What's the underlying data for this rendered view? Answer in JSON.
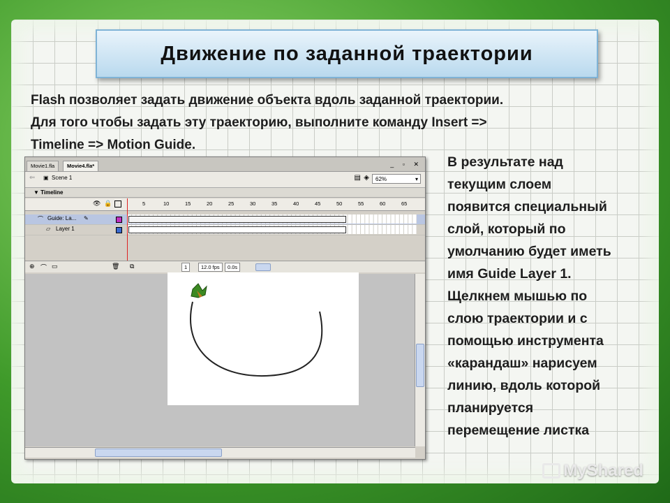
{
  "slide": {
    "title": "Движение по заданной траектории",
    "intro_lines": [
      "Flash позволяет задать движение объекта вдоль заданной траектории.",
      "Для того чтобы задать эту траекторию, выполните команду Insert =>",
      "Timeline => Motion Guide."
    ],
    "side_lines": [
      "В результате над",
      "текущим слоем",
      "появится специальный",
      "слой, который по",
      "умолчанию будет иметь",
      "имя Guide Layer 1.",
      "Щелкнем мышью по",
      "слою траектории и с",
      "помощью инструмента",
      "«карандаш» нарисуем",
      "линию, вдоль которой",
      "планируется",
      "перемещение листка"
    ]
  },
  "flash": {
    "tabs": [
      "Movie1.fla",
      "Movie4.fla*"
    ],
    "scene": "Scene 1",
    "zoom": "62%",
    "timeline_label": "Timeline",
    "ruler": [
      "5",
      "10",
      "15",
      "20",
      "25",
      "30",
      "35",
      "40",
      "45",
      "50",
      "55",
      "60",
      "65"
    ],
    "layers": [
      "Guide: La...",
      "Layer 1"
    ],
    "frame": "1",
    "fps": "12.0 fps",
    "time": "0.0s"
  },
  "watermark": "MyShared",
  "colors": {
    "background": "#3f9a2a",
    "title_box": "#b9d9ee",
    "path": "#222222"
  }
}
